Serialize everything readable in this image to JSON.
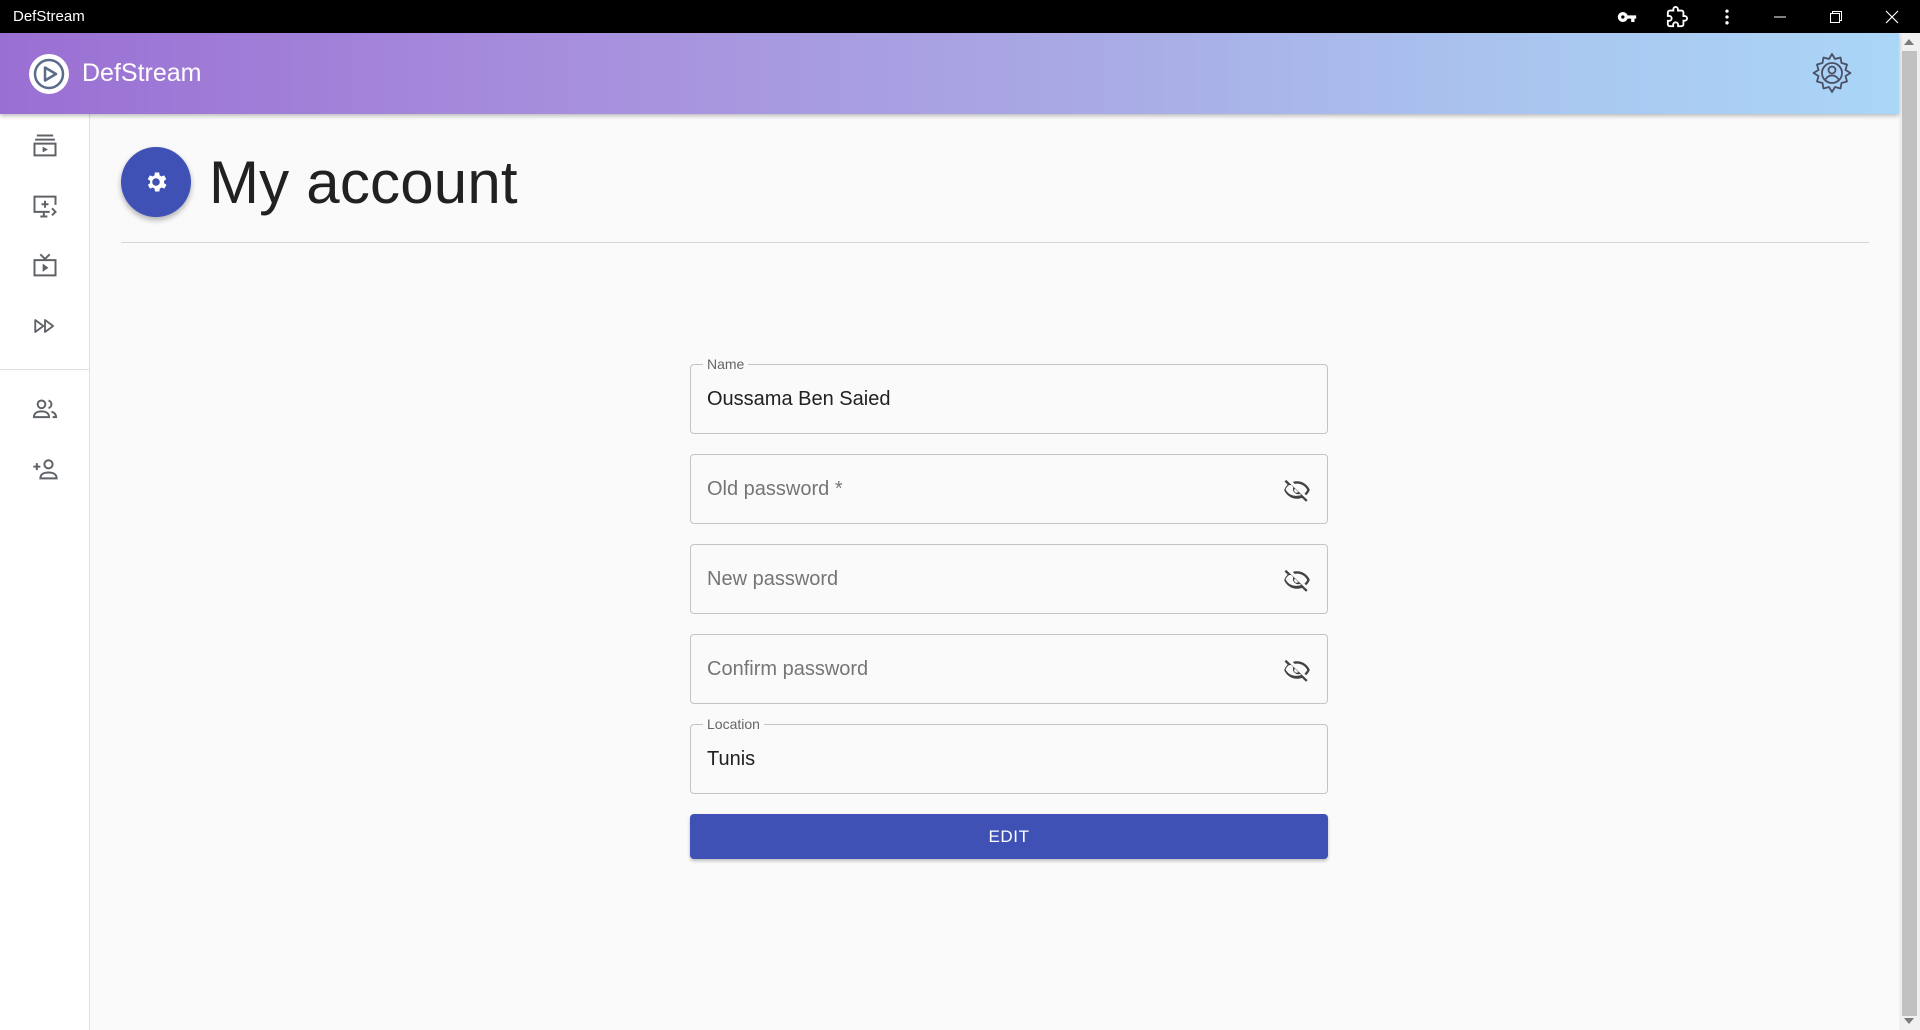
{
  "window": {
    "title": "DefStream",
    "icons": [
      "key-icon",
      "extension-icon",
      "more-vert-icon"
    ],
    "controls": [
      "minimize-icon",
      "restore-icon",
      "close-icon"
    ]
  },
  "header": {
    "brand": "DefStream",
    "logo_icon": "play-logo-icon",
    "settings_icon": "account-settings-icon"
  },
  "sidebar": {
    "items": [
      {
        "icon": "video-library-icon"
      },
      {
        "icon": "add-to-queue-icon"
      },
      {
        "icon": "live-tv-icon"
      },
      {
        "icon": "fast-forward-icon"
      }
    ],
    "items2": [
      {
        "icon": "people-icon"
      },
      {
        "icon": "person-add-icon"
      }
    ]
  },
  "page": {
    "title": "My account",
    "header_icon": "settings-icon"
  },
  "form": {
    "name": {
      "label": "Name",
      "value": "Oussama Ben Saied"
    },
    "old_password": {
      "placeholder": "Old password *"
    },
    "new_password": {
      "placeholder": "New password"
    },
    "confirm_password": {
      "placeholder": "Confirm password"
    },
    "location": {
      "label": "Location",
      "value": "Tunis"
    },
    "submit_label": "EDIT"
  },
  "colors": {
    "primary": "#3f51b5",
    "header_gradient_start": "#9a6fd3",
    "header_gradient_end": "#aad6f7"
  }
}
